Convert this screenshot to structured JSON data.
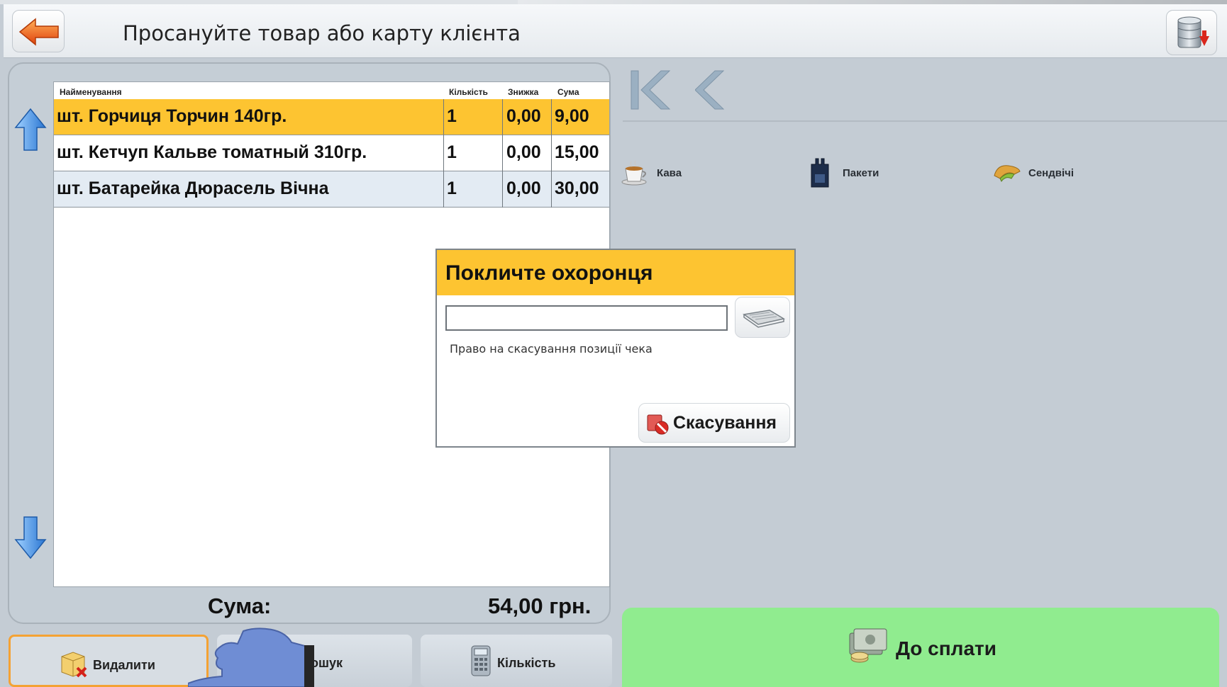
{
  "header": {
    "prompt": "Просануйте товар або карту клієнта"
  },
  "receipt": {
    "columns": [
      "Найменування",
      "Кількість",
      "Знижка",
      "Сума"
    ],
    "rows": [
      {
        "name": "шт. Горчиця  Торчин 140гр.",
        "qty": "1",
        "discount": "0,00",
        "sum": "9,00",
        "selected": true
      },
      {
        "name": "шт. Кетчуп Кальве томатный 310гр.",
        "qty": "1",
        "discount": "0,00",
        "sum": "15,00",
        "selected": false
      },
      {
        "name": "шт. Батарейка Дюрасель Вічна",
        "qty": "1",
        "discount": "0,00",
        "sum": "30,00",
        "selected": false
      }
    ],
    "total_label": "Сума:",
    "total_value": "54,00 грн."
  },
  "toolbar": {
    "delete_label": "Видалити",
    "search_label": "Пошук",
    "search_visible_label": "ошук",
    "quantity_label": "Кількість"
  },
  "categories": [
    {
      "label": "Кава",
      "icon": "coffee-cup-icon"
    },
    {
      "label": "Пакети",
      "icon": "bag-icon"
    },
    {
      "label": "Сендвічі",
      "icon": "sandwich-icon"
    }
  ],
  "pay": {
    "label": "До сплати",
    "color": "#90ec8f"
  },
  "dialog": {
    "title": "Покличте охоронця",
    "input_value": "",
    "description": "Право на скасування позиції чека",
    "cancel_label": "Скасування",
    "header_color": "#fdc431"
  },
  "colors": {
    "selected_row": "#fdc431",
    "background": "#c4ccd4",
    "highlight_border": "#f4a234"
  }
}
